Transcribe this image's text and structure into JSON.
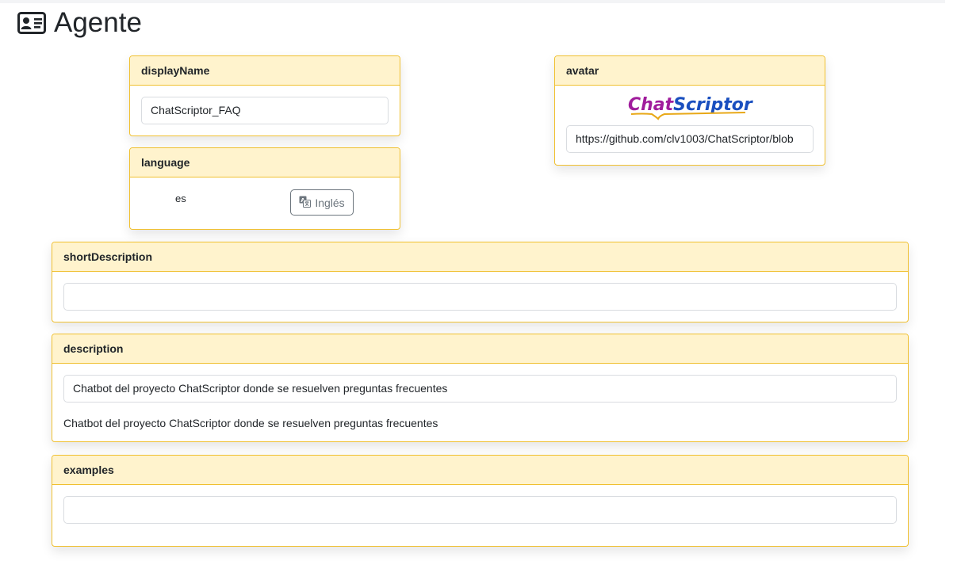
{
  "page": {
    "title": "Agente",
    "title_icon": "id-card-icon"
  },
  "displayName": {
    "header": "displayName",
    "value": "ChatScriptor_FAQ"
  },
  "language": {
    "header": "language",
    "code": "es",
    "translate_button_label": "Inglés",
    "translate_icon": "translate-icon"
  },
  "avatar": {
    "header": "avatar",
    "logo_text_a": "Chat",
    "logo_text_b": "Scriptor",
    "logo_colors": {
      "chat": "#a01c9c",
      "scriptor": "#1a4fbf",
      "underline": "#e8a817"
    },
    "url_value": "https://github.com/clv1003/ChatScriptor/blob"
  },
  "shortDescription": {
    "header": "shortDescription",
    "value": ""
  },
  "description": {
    "header": "description",
    "value": "Chatbot del proyecto ChatScriptor donde se resuelven preguntas frecuentes",
    "preview": "Chatbot del proyecto ChatScriptor donde se resuelven preguntas frecuentes"
  },
  "examples": {
    "header": "examples",
    "value": ""
  },
  "colors": {
    "card_border": "#f0c030",
    "card_header_bg": "#fff3cd"
  }
}
